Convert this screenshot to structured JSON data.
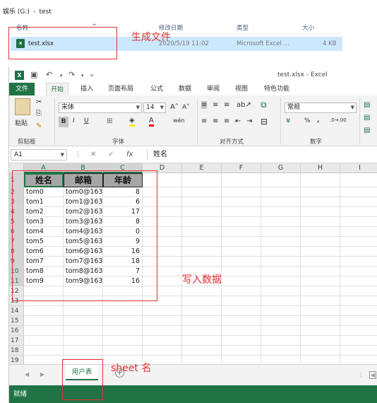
{
  "explorer": {
    "breadcrumb": [
      "娱乐 (G:)",
      "test"
    ],
    "columns": {
      "name": "名称",
      "modified": "修改日期",
      "type": "类型",
      "size": "大小"
    },
    "file": {
      "icon": "excel-file-icon",
      "name": "test.xlsx",
      "modified": "2020/5/19 11:02",
      "type": "Microsoft Excel ...",
      "size": "4 KB"
    }
  },
  "annotations": {
    "generate_file": "生成文件",
    "write_data": "写入数据",
    "sheet_name": "sheet 名"
  },
  "excel": {
    "window_title": "test.xlsx - Excel",
    "tabs": [
      "文件",
      "开始",
      "插入",
      "页面布局",
      "公式",
      "数据",
      "审阅",
      "视图",
      "特色功能"
    ],
    "active_tab": "开始",
    "ribbon": {
      "paste": "粘贴",
      "groups": [
        "剪贴板",
        "字体",
        "对齐方式",
        "数字"
      ],
      "font_name": "宋体",
      "font_size": "14",
      "bold": "B",
      "italic": "I",
      "underline": "U",
      "number_format": "常规",
      "percent": "%",
      "comma": ","
    },
    "name_box": "A1",
    "formula": "姓名",
    "columns": [
      "A",
      "B",
      "C",
      "D",
      "E",
      "F",
      "G",
      "H",
      "I"
    ],
    "rows": [
      "1",
      "2",
      "3",
      "4",
      "5",
      "6",
      "7",
      "8",
      "9",
      "10",
      "11",
      "12",
      "13",
      "14",
      "15",
      "16",
      "17",
      "18",
      "19"
    ],
    "headers": [
      "姓名",
      "邮箱",
      "年龄"
    ],
    "data": [
      [
        "tom0",
        "tom0@163.",
        "8"
      ],
      [
        "tom1",
        "tom1@163.",
        "6"
      ],
      [
        "tom2",
        "tom2@163.",
        "17"
      ],
      [
        "tom3",
        "tom3@163.",
        "8"
      ],
      [
        "tom4",
        "tom4@163.",
        "0"
      ],
      [
        "tom5",
        "tom5@163.",
        "9"
      ],
      [
        "tom6",
        "tom6@163.",
        "16"
      ],
      [
        "tom7",
        "tom7@163.",
        "18"
      ],
      [
        "tom8",
        "tom8@163.",
        "7"
      ],
      [
        "tom9",
        "tom9@163.",
        "16"
      ]
    ],
    "sheet_tab": "用户表",
    "status": "就绪"
  }
}
